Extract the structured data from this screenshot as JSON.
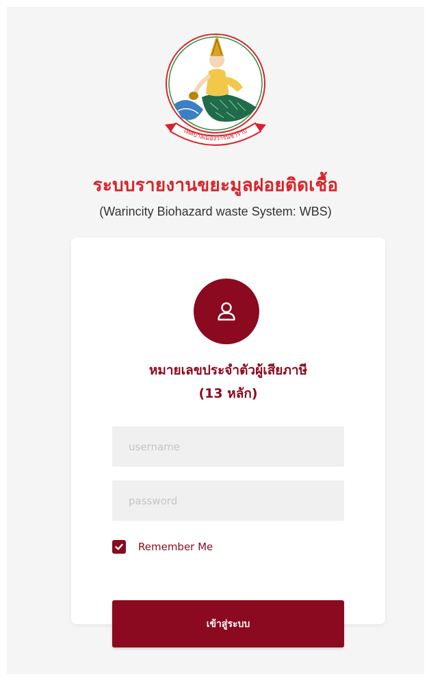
{
  "header": {
    "title": "ระบบรายงานขยะมูลฝอยติดเชื้อ",
    "subtitle": "(Warincity Biohazard waste System: WBS)",
    "seal_text": "เทศบาลเมืองวารินชำราบ",
    "seal_icon": "municipal-seal-icon"
  },
  "login": {
    "avatar_icon": "user-icon",
    "heading_line1": "หมายเลขประจำตัวผู้เสียภาษี",
    "heading_line2": "(13 หลัก)",
    "username_placeholder": "username",
    "username_value": "",
    "password_placeholder": "password",
    "password_value": "",
    "remember_label": "Remember Me",
    "remember_checked": true,
    "submit_label": "เข้าสู่ระบบ"
  },
  "colors": {
    "brand": "#8b0a1f",
    "title_red": "#d8232a",
    "page_bg": "#f5f5f5",
    "field_bg": "#f0f0f0"
  }
}
